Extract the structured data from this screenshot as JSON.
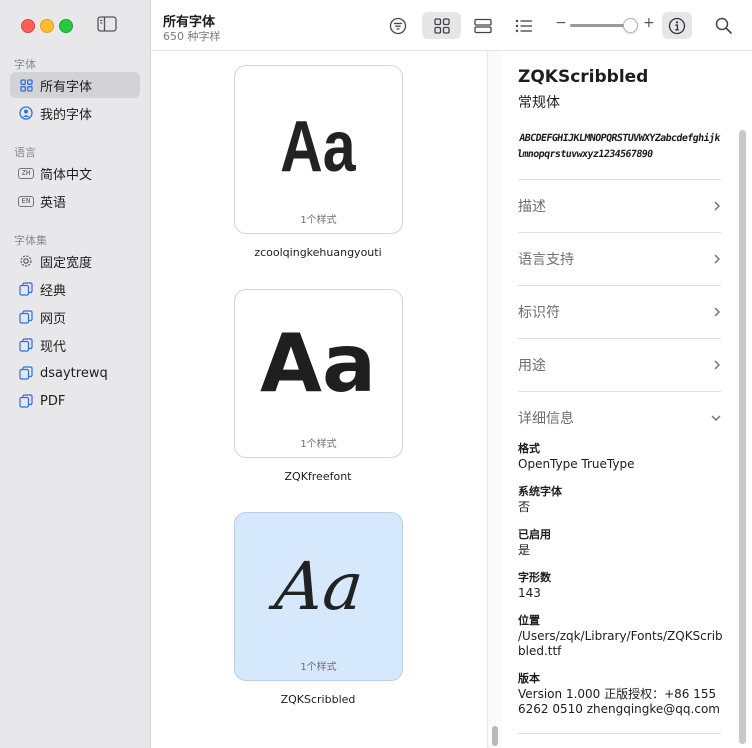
{
  "sidebar": {
    "sections": [
      {
        "title": "字体",
        "items": [
          {
            "label": "所有字体",
            "icon": "grid-icon",
            "selected": true
          },
          {
            "label": "我的字体",
            "icon": "person-icon",
            "selected": false
          }
        ]
      },
      {
        "title": "语言",
        "items": [
          {
            "label": "简体中文",
            "icon": "zh-badge-icon",
            "badge": "ZH"
          },
          {
            "label": "英语",
            "icon": "en-badge-icon",
            "badge": "EN"
          }
        ]
      },
      {
        "title": "字体集",
        "items": [
          {
            "label": "固定宽度",
            "icon": "gear-icon"
          },
          {
            "label": "经典",
            "icon": "collection-icon"
          },
          {
            "label": "网页",
            "icon": "collection-icon"
          },
          {
            "label": "现代",
            "icon": "collection-icon"
          },
          {
            "label": "dsaytrewq",
            "icon": "collection-icon"
          },
          {
            "label": "PDF",
            "icon": "collection-icon"
          }
        ]
      }
    ]
  },
  "toolbar": {
    "title": "所有字体",
    "subtitle": "650 种字样",
    "zoom_minus": "−",
    "zoom_plus": "+",
    "zoom_level": 0.9,
    "colors": {
      "accent": "#2f6fe4",
      "selected_card": "#d6e8fc"
    }
  },
  "grid": {
    "cards": [
      {
        "sample": "Aa",
        "count": "1个样式",
        "name": "zcoolqingkehuangyouti",
        "selected": false
      },
      {
        "sample": "Aa",
        "count": "1个样式",
        "name": "ZQKfreefont",
        "selected": false
      },
      {
        "sample": "Aa",
        "count": "1个样式",
        "name": "ZQKScribbled",
        "selected": true
      }
    ]
  },
  "info": {
    "font_name": "ZQKScribbled",
    "style": "常规体",
    "preview": "ABCDEFGHIJKLMNOPQRSTUVWXYZabcdefghijklmnopqrstuvwxyz1234567890",
    "rows": [
      "描述",
      "语言支持",
      "标识符",
      "用途"
    ],
    "details_title": "详细信息",
    "details": [
      {
        "label": "格式",
        "value": "OpenType TrueType"
      },
      {
        "label": "系统字体",
        "value": "否"
      },
      {
        "label": "已启用",
        "value": "是"
      },
      {
        "label": "字形数",
        "value": "143"
      },
      {
        "label": "位置",
        "value": "/Users/zqk/Library/Fonts/ZQKScribbled.ttf"
      },
      {
        "label": "版本",
        "value": "Version 1.000 正版授权：+86 155 6262 0510  zhengqingke@qq.com"
      }
    ]
  }
}
